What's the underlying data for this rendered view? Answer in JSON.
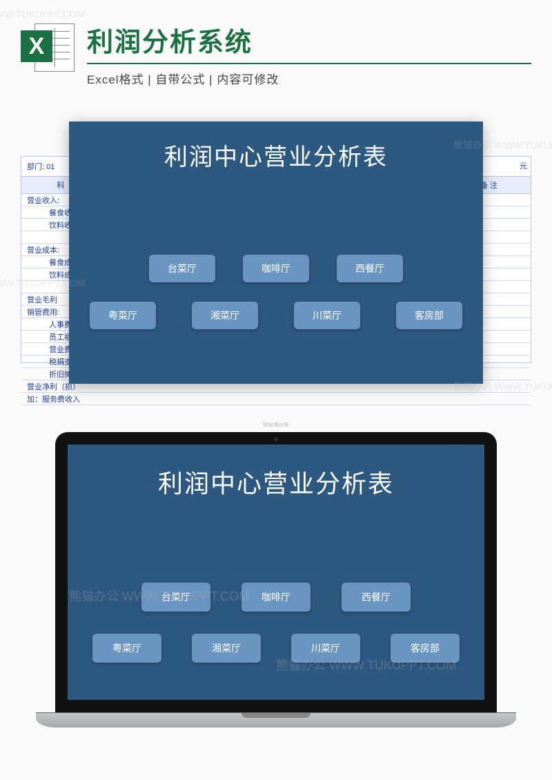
{
  "header": {
    "title": "利润分析系统",
    "sub_format": "Excel格式",
    "sub_formula": "自带公式",
    "sub_editable": "内容可修改",
    "icon_letter": "X"
  },
  "panel": {
    "title": "利润中心营业分析表"
  },
  "buttons": {
    "row1": [
      "台菜厅",
      "咖啡厅",
      "西餐厅"
    ],
    "row2": [
      "粤菜厅",
      "湘菜厅",
      "川菜厅",
      "客房部"
    ]
  },
  "spreadsheet": {
    "dept_label": "部门: 01",
    "col_subject": "科　目",
    "col_unit": "元",
    "col_remark": "备 注",
    "rows": [
      "营业收入:",
      "餐食收",
      "饮料收",
      "",
      "营业成本:",
      "餐食成",
      "饮料成",
      "",
      "营业毛利",
      "销管费用:",
      "人事费用",
      "员工福利",
      "营业费用",
      "税捐支出",
      "折旧摊提",
      "营业净利（损）",
      "加：服务费收入"
    ]
  },
  "laptop": {
    "brand": "MacBook"
  },
  "watermarks": [
    "熊猫办公 WWW.TUKUPPT.COM"
  ]
}
